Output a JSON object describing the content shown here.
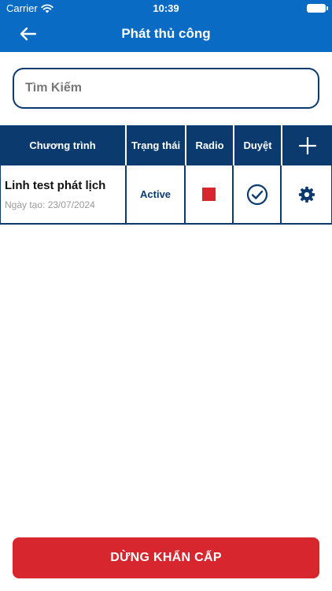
{
  "status_bar": {
    "carrier": "Carrier",
    "time": "10:39"
  },
  "header": {
    "title": "Phát thủ công",
    "back_icon": "arrow-left-icon"
  },
  "search": {
    "placeholder": "Tìm Kiếm",
    "value": ""
  },
  "table": {
    "columns": [
      "Chương trình",
      "Trạng thái",
      "Radio",
      "Duyệt"
    ],
    "add_icon": "plus-icon",
    "rows": [
      {
        "name": "Linh test phát lịch",
        "created": "Ngày tạo: 23/07/2024",
        "status": "Active",
        "radio_icon": "stop-icon",
        "approve_icon": "check-circle-icon",
        "settings_icon": "gear-icon"
      }
    ]
  },
  "footer": {
    "emergency_label": "DỪNG KHẨN CẤP"
  },
  "colors": {
    "header_blue": "#0a6bc4",
    "navy": "#0b3a6e",
    "danger_red": "#d7262e",
    "muted_gray": "#9a9a9a"
  }
}
